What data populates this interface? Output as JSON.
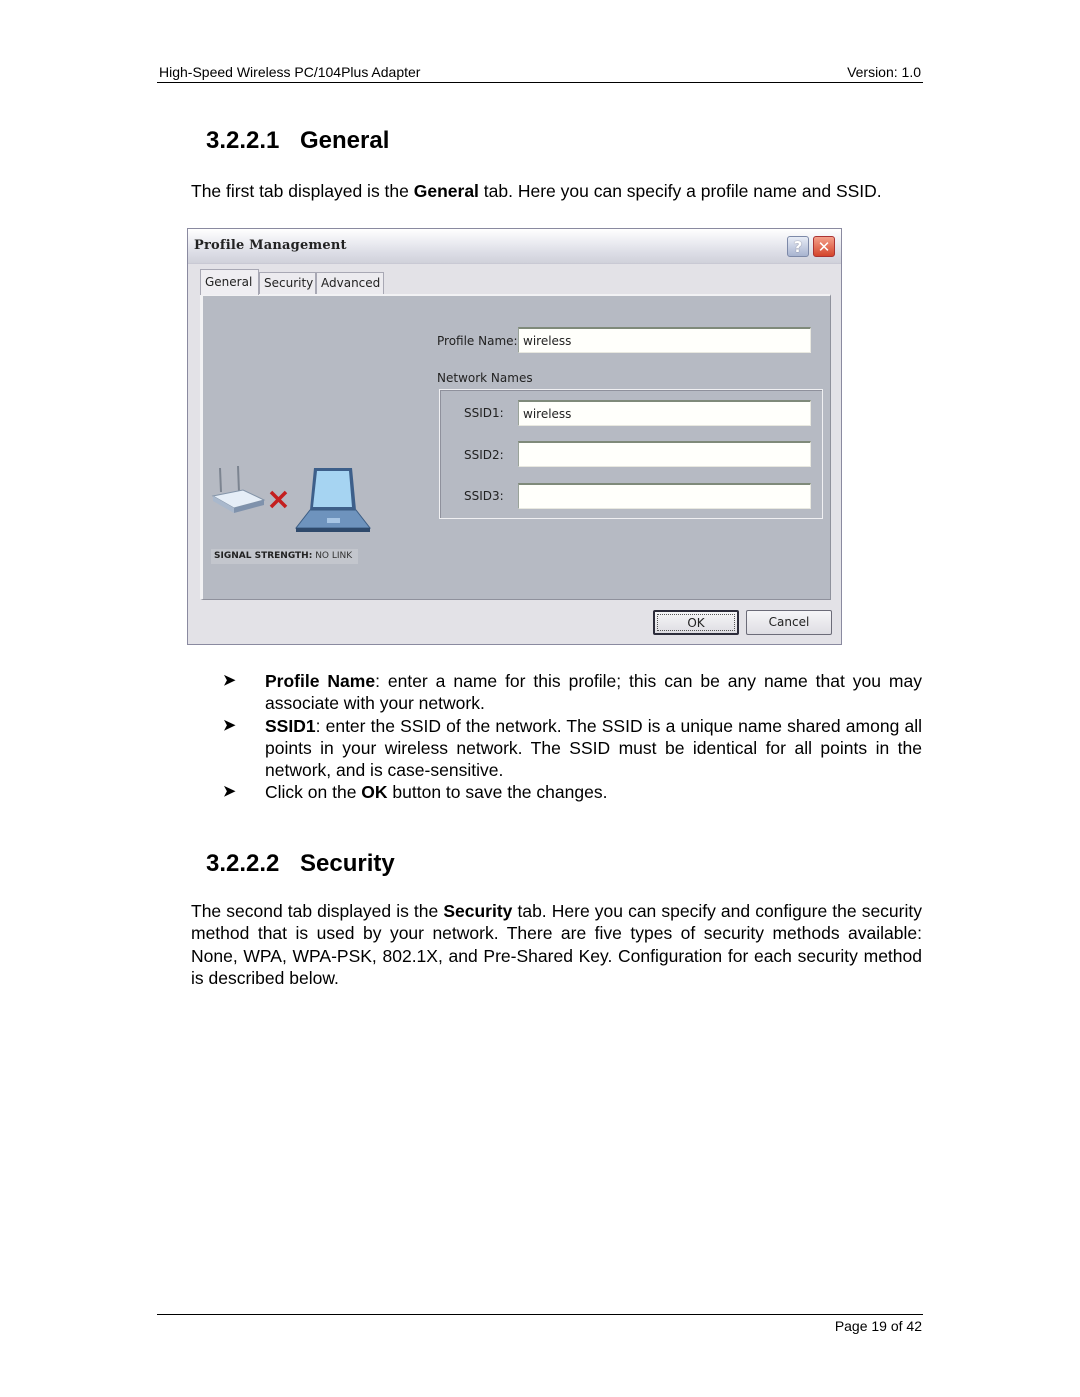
{
  "header": {
    "title": "High-Speed Wireless PC/104Plus Adapter",
    "version": "Version: 1.0"
  },
  "sections": [
    {
      "number": "3.2.2.1",
      "title": "General",
      "intro": {
        "prefix": "The first tab displayed is the ",
        "bold": "General",
        "suffix": " tab. Here you can specify a profile name and SSID."
      }
    },
    {
      "number": "3.2.2.2",
      "title": "Security",
      "intro": {
        "prefix": "The second tab displayed is the ",
        "bold": "Security",
        "suffix": " tab. Here you can specify and configure the security method that is used by your network.  There are five types of security methods available: None, WPA, WPA-PSK, 802.1X, and Pre-Shared Key. Configuration for each security method is described below."
      }
    }
  ],
  "dialog": {
    "title": "Profile Management",
    "help_icon": "help-icon",
    "close_icon": "close-icon",
    "tabs": [
      {
        "label": "General",
        "active": true
      },
      {
        "label": "Security",
        "active": false
      },
      {
        "label": "Advanced",
        "active": false
      }
    ],
    "profile_name_label": "Profile Name:",
    "profile_name_value": "wireless",
    "network_names_label": "Network Names",
    "ssids": [
      {
        "label": "SSID1:",
        "value": "wireless"
      },
      {
        "label": "SSID2:",
        "value": ""
      },
      {
        "label": "SSID3:",
        "value": ""
      }
    ],
    "signal_label": "SIGNAL STRENGTH:",
    "signal_value": "NO LINK",
    "illustration": [
      "router-icon",
      "no-link-x-icon",
      "laptop-icon"
    ],
    "ok_label": "OK",
    "cancel_label": "Cancel"
  },
  "bullets": [
    {
      "bold": "Profile Name",
      "text": ": enter a name for this profile; this can be any name that you may associate with your network."
    },
    {
      "bold": "SSID1",
      "text": ": enter the SSID of the network. The SSID is a unique name shared among all points in your wireless network. The SSID must be identical for all points in the network, and is case-sensitive."
    },
    {
      "prefix": "Click on the ",
      "bold": "OK",
      "text": " button to save the changes."
    }
  ],
  "bullet_glyph": "➤",
  "footer": {
    "page": "Page 19 of 42"
  }
}
